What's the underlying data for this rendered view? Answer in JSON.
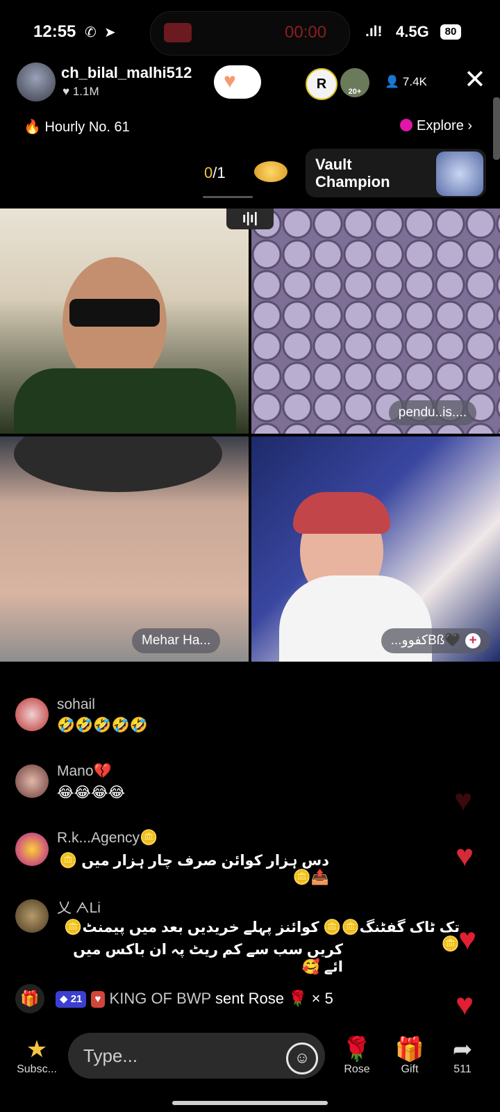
{
  "status_bar": {
    "time": "12:55",
    "record_timer": "00:00",
    "network": "4.5G",
    "battery": "80"
  },
  "host": {
    "name": "ch_bilal_malhi512",
    "likes": "1.1M",
    "viewer_badge": "20+",
    "viewer_count": "7.4K"
  },
  "ranking": {
    "hourly": "Hourly No. 61",
    "explore": "Explore"
  },
  "goal": {
    "current": "0",
    "total": "/1",
    "banner": "Vault\nChampion"
  },
  "guests": {
    "tile2_name": "pendu..is....",
    "tile3_name": "Mehar Ha...",
    "tile4_name": "...كفووBß🖤"
  },
  "comments": [
    {
      "name": "sohail",
      "text": "🤣🤣🤣🤣🤣"
    },
    {
      "name": "Mano💔",
      "text": "😂😂😂😂"
    },
    {
      "name": "R.k...Agency🪙",
      "text": "دس ہزار کوائن صرف چار ہزار میں 🪙📤🪙"
    },
    {
      "name": "乂 ᗅLi",
      "text_line1": "تک ٹاک گفٹنگ🪙🪙 کوائنز پہلے خریدیں بعد میں پیمنٹ🪙🪙",
      "text_line2": "کریں سب سے کم ریٹ پہ ان باکس میں ائے 🥰"
    }
  ],
  "gift_event": {
    "level": "21",
    "user": "KING OF BWP",
    "action": "sent Rose",
    "count": "× 5"
  },
  "bottom_bar": {
    "subscribe": "Subsc...",
    "input_placeholder": "Type...",
    "rose": "Rose",
    "gift": "Gift",
    "share_count": "511"
  }
}
